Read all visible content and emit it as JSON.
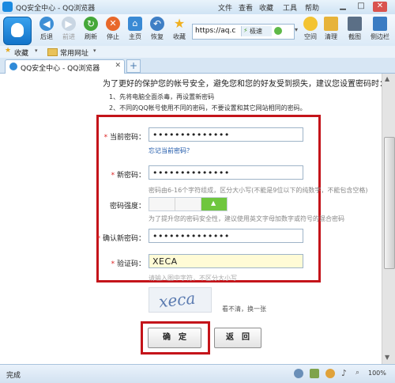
{
  "window": {
    "title": "QQ安全中心 - QQ浏览器",
    "menu": [
      "文件",
      "查看",
      "收藏",
      "工具",
      "帮助"
    ]
  },
  "toolbar": {
    "buttons": [
      {
        "label": "后退",
        "icon": "back-arrow-icon"
      },
      {
        "label": "前进",
        "icon": "forward-arrow-icon"
      },
      {
        "label": "刷新",
        "icon": "refresh-icon"
      },
      {
        "label": "停止",
        "icon": "stop-icon"
      },
      {
        "label": "主页",
        "icon": "home-icon"
      },
      {
        "label": "恢复",
        "icon": "undo-icon"
      },
      {
        "label": "收藏",
        "icon": "star-icon"
      }
    ],
    "address": "https://aq.c",
    "secure_label": "极速",
    "right_buttons": [
      {
        "label": "空间",
        "icon": "space-icon"
      },
      {
        "label": "清理",
        "icon": "broom-icon"
      },
      {
        "label": "截图",
        "icon": "screenshot-icon"
      },
      {
        "label": "侧边栏",
        "icon": "sidebar-icon"
      }
    ]
  },
  "bookmarks_bar": {
    "favorites_label": "收藏",
    "common_sites_label": "常用网址"
  },
  "tabs": [
    {
      "label": "QQ安全中心 - QQ浏览器",
      "active": true
    }
  ],
  "page": {
    "intro": "为了更好的保护您的帐号安全，避免您和您的好友受到损失，建议您设置密码时：",
    "notes": [
      "1、先将电脑全面杀毒，再设置新密码",
      "2、不同的QQ帐号使用不同的密码，不要设置和其它网站相同的密码。"
    ],
    "form": {
      "current_password": {
        "label": "当前密码：",
        "required": "*",
        "value": "••••••••••••••"
      },
      "forgot_link": "忘记当前密码？",
      "new_password": {
        "label": "新密码：",
        "required": "*",
        "value": "••••••••••••••",
        "hint": "密码由6-16个字符组成，区分大小写(不能是9位以下的纯数字，不能包含空格)"
      },
      "strength": {
        "label": "密码强度：",
        "level": 3,
        "max": 3
      },
      "strength_hint": "为了提升您的密码安全性，建议使用英文字母加数字或符号的混合密码",
      "confirm_password": {
        "label": "确认新密码：",
        "required": "*",
        "value": "••••••••••••••"
      },
      "captcha": {
        "label": "验证码：",
        "required": "*",
        "value": "XECA",
        "hint": "请输入图中字符，不区分大小写",
        "image_text": "xeca",
        "refresh_label": "看不清，换一张"
      },
      "ok_label": "确　定",
      "back_label": "返　回"
    }
  },
  "status": {
    "text": "完成",
    "zoom": "100%"
  },
  "colors": {
    "highlight": "#c4141a",
    "captcha_bg": "#fffbd6",
    "strength_fill": "#6fc63e"
  }
}
